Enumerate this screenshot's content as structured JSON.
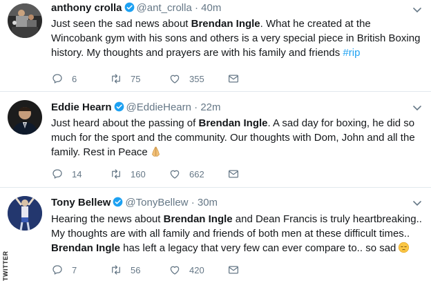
{
  "tweets": [
    {
      "name": "anthony crolla",
      "handle": "@ant_crolla",
      "dot": "·",
      "time": "40m",
      "text_parts": [
        "Just seen the sad news about ",
        "Brendan Ingle",
        ". What he created at the Wincobank gym with his sons and others is a very special piece in British Boxing history. My thoughts and prayers are with his family and friends ",
        "#rip"
      ],
      "replies": "6",
      "retweets": "75",
      "likes": "355"
    },
    {
      "name": "Eddie Hearn",
      "handle": "@EddieHearn",
      "dot": "·",
      "time": "22m",
      "text_parts": [
        "Just heard about the passing of ",
        "Brendan Ingle",
        ". A sad day for boxing, he did so much for the sport and the community. Our thoughts with Dom, John and all the family. Rest in Peace"
      ],
      "replies": "14",
      "retweets": "160",
      "likes": "662"
    },
    {
      "name": "Tony Bellew",
      "handle": "@TonyBellew",
      "dot": "·",
      "time": "30m",
      "text_parts": [
        "Hearing the news about ",
        "Brendan Ingle",
        " and Dean Francis is truly heartbreaking.. My thoughts are with all family and friends of both men at these difficult times.. ",
        "Brendan Ingle",
        " has left a legacy that very few can ever compare to.. so sad"
      ],
      "replies": "7",
      "retweets": "56",
      "likes": "420"
    }
  ],
  "credit": "TWITTER",
  "colors": {
    "verified": "#1da1f2",
    "hashtag": "#1da1f2",
    "muted": "#657786",
    "divider": "#e1e8ed"
  },
  "icons": [
    "reply-icon",
    "retweet-icon",
    "like-icon",
    "direct-message-icon",
    "chevron-down-icon",
    "verified-badge-icon",
    "praying-hands-emoji",
    "pensive-face-emoji"
  ]
}
